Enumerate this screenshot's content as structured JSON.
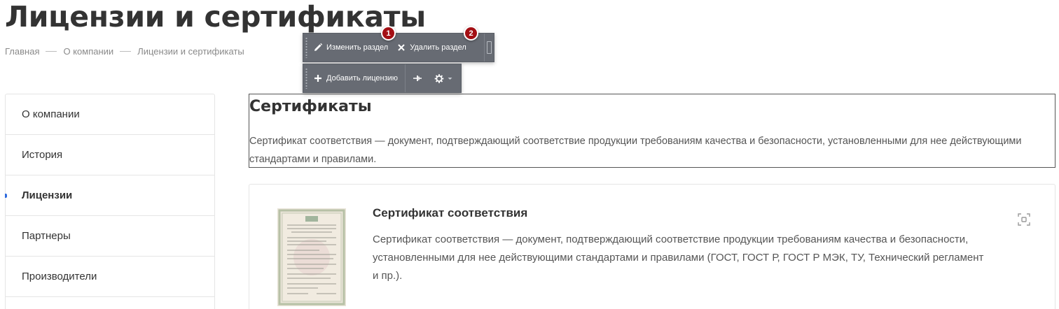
{
  "page": {
    "title": "Лицензии и сертификаты"
  },
  "breadcrumb": [
    {
      "label": "Главная"
    },
    {
      "label": "О компании"
    },
    {
      "label": "Лицензии и сертификаты"
    }
  ],
  "toolbar": {
    "edit_section": "Изменить раздел",
    "delete_section": "Удалить раздел",
    "add_license": "Добавить лицензию",
    "badge_1": "1",
    "badge_2": "2"
  },
  "sidebar": {
    "items": [
      {
        "label": "О компании"
      },
      {
        "label": "История"
      },
      {
        "label": "Лицензии",
        "active": true
      },
      {
        "label": "Партнеры"
      },
      {
        "label": "Производители"
      }
    ]
  },
  "section": {
    "title": "Сертификаты",
    "description": "Сертификат соответствия — документ, подтверждающий соответствие продукции требованиям качества и безопасности, установленными для нее действующими стандартами и правилами."
  },
  "certificate": {
    "title": "Сертификат соответствия",
    "text": "Сертификат соответствия — документ, подтверждающий соответствие продукции требованиям качества и безопасности, установленными для нее действующими стандартами и правилами (ГОСТ, ГОСТ Р, ГОСТ Р МЭК, ТУ, Технический регламент и пр.).",
    "zoom_icon": "zoom-icon"
  },
  "colors": {
    "toolbar_bg": "#676b73",
    "badge": "#a30f14",
    "accent": "#2f6bde",
    "text": "#333333",
    "muted": "#8a8a8a"
  }
}
